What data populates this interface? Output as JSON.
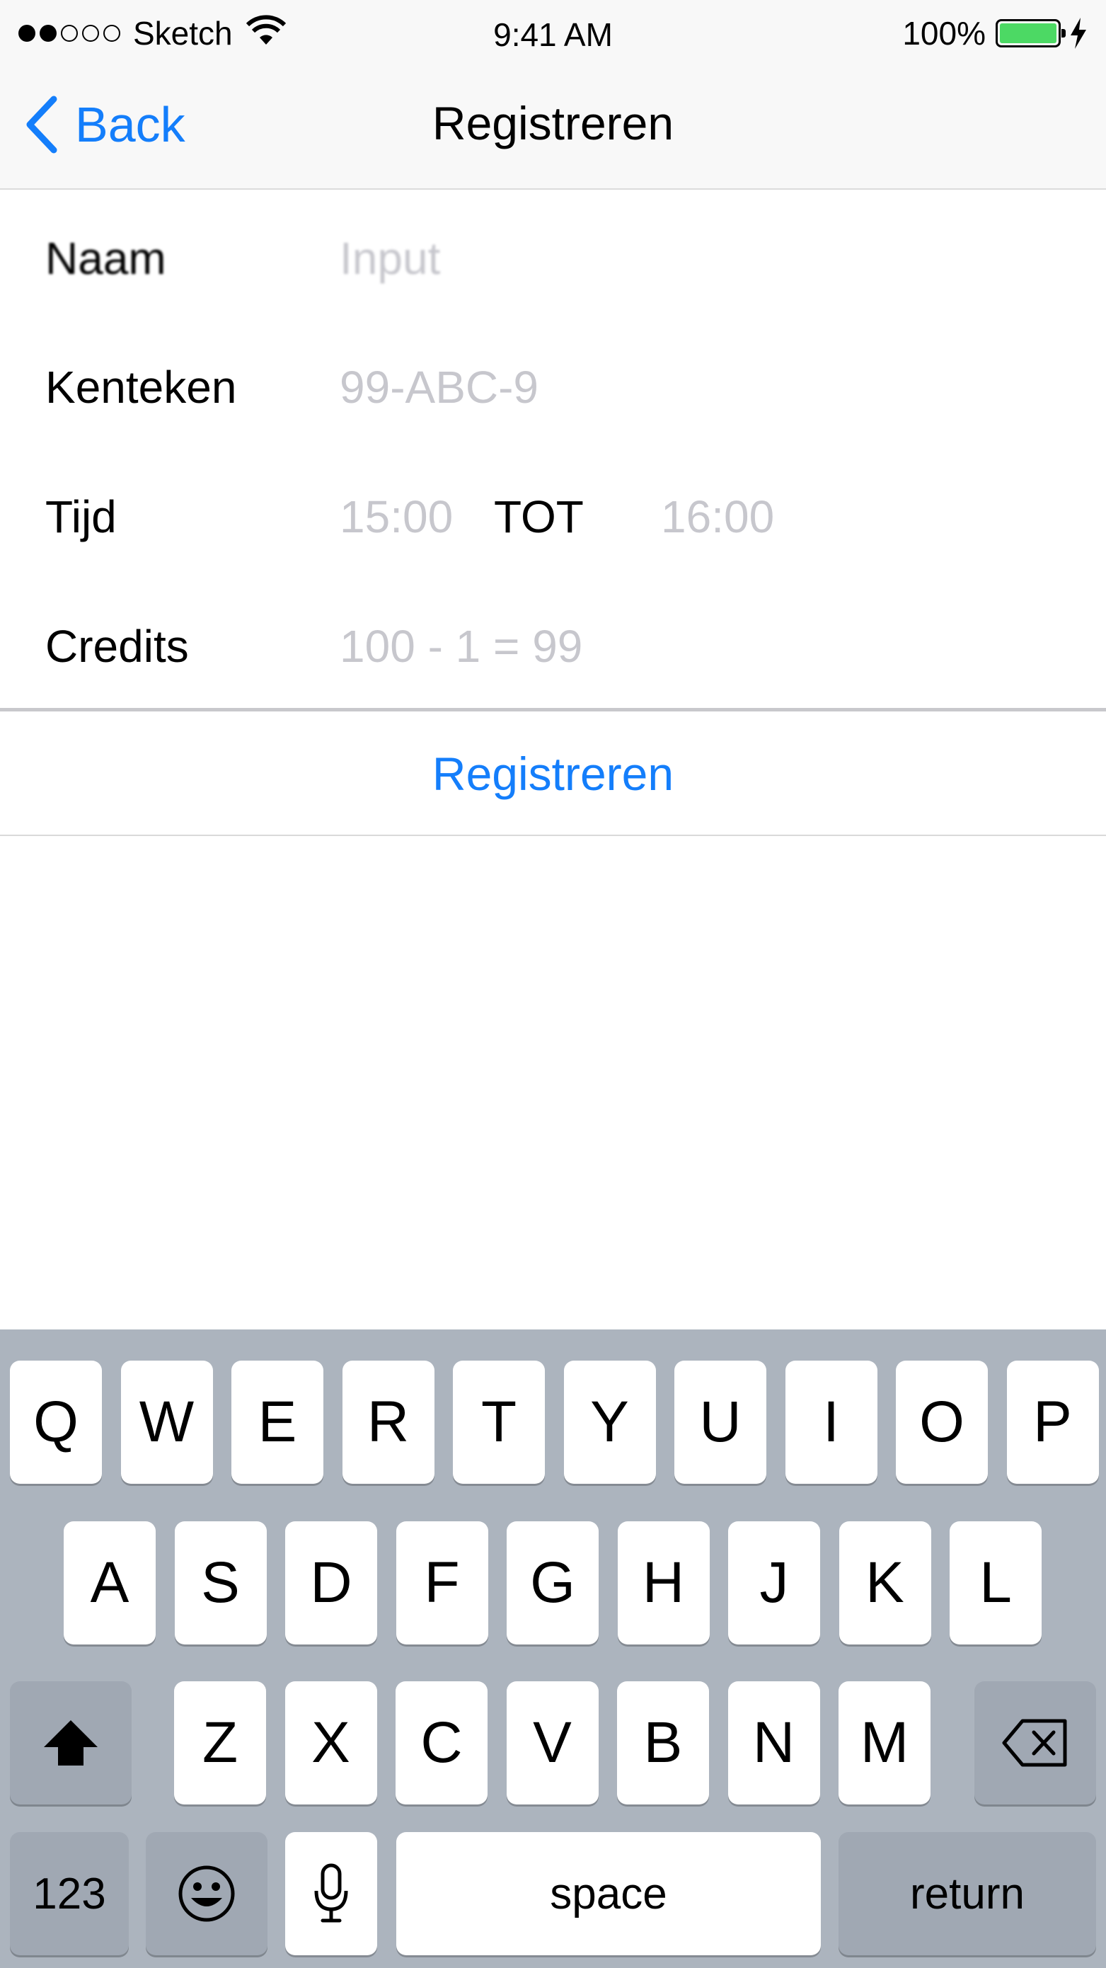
{
  "status_bar": {
    "carrier": "Sketch",
    "time": "9:41 AM",
    "battery_percent": "100%",
    "battery_color": "#4cd964",
    "signal_bars_filled": 2,
    "signal_bars_total": 5
  },
  "nav": {
    "back_label": "Back",
    "title": "Registreren",
    "accent_color": "#147efb"
  },
  "form": {
    "naam": {
      "label": "Naam",
      "placeholder": "Input"
    },
    "kenteken": {
      "label": "Kenteken",
      "placeholder": "99-ABC-9"
    },
    "tijd": {
      "label": "Tijd",
      "from": "15:00",
      "separator": "TOT",
      "to": "16:00"
    },
    "credits": {
      "label": "Credits",
      "value": "100 - 1 = 99"
    }
  },
  "submit_label": "Registreren",
  "keyboard": {
    "row1": [
      "Q",
      "W",
      "E",
      "R",
      "T",
      "Y",
      "U",
      "I",
      "O",
      "P"
    ],
    "row2": [
      "A",
      "S",
      "D",
      "F",
      "G",
      "H",
      "J",
      "K",
      "L"
    ],
    "row3": [
      "Z",
      "X",
      "C",
      "V",
      "B",
      "N",
      "M"
    ],
    "numbers_label": "123",
    "space_label": "space",
    "return_label": "return",
    "icons": [
      "shift-icon",
      "backspace-icon",
      "emoji-icon",
      "microphone-icon"
    ]
  }
}
